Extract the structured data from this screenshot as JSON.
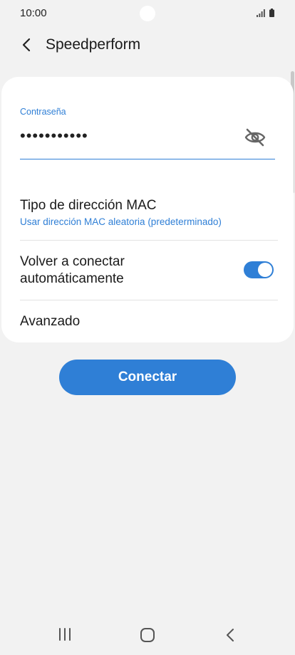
{
  "status_bar": {
    "time": "10:00",
    "signal_icon": "signal-icon",
    "battery_icon": "battery-icon"
  },
  "app_bar": {
    "back_icon": "chevron-left-icon",
    "title": "Speedperform"
  },
  "form": {
    "password_label": "Contraseña",
    "password_value": "•••••••••••",
    "visibility_icon": "eye-off-icon",
    "mac": {
      "title": "Tipo de dirección MAC",
      "subtitle": "Usar dirección MAC aleatoria (predeterminado)"
    },
    "auto_reconnect": {
      "label": "Volver a conectar automáticamente",
      "enabled": true
    },
    "advanced_label": "Avanzado"
  },
  "connect_button": {
    "label": "Conectar"
  },
  "nav_bar": {
    "recents_icon": "recents-icon",
    "home_icon": "home-icon",
    "back_icon": "back-icon"
  },
  "colors": {
    "accent": "#2f7fd6",
    "background": "#f2f2f2",
    "card": "#ffffff"
  }
}
